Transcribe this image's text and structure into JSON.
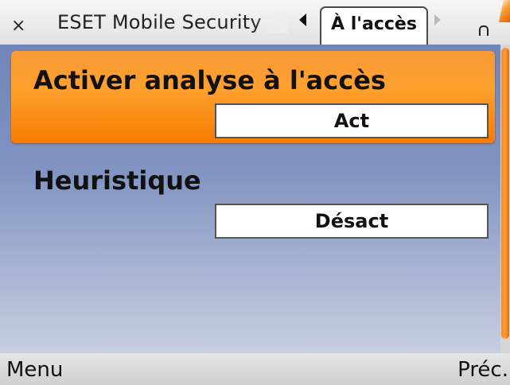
{
  "topbar": {
    "close_icon": "×",
    "app_title": "ESET Mobile Security",
    "active_tab_label": "À l'accès",
    "left_arrow_icon": "tab-prev-arrow",
    "right_arrow_icon": "tab-next-arrow",
    "indicator_icon": "lock-indicator-icon"
  },
  "settings": {
    "items": [
      {
        "label": "Activer analyse à l'accès",
        "value": "Act",
        "selected": true
      },
      {
        "label": "Heuristique",
        "value": "Désact",
        "selected": false
      }
    ]
  },
  "softkeys": {
    "left": "Menu",
    "right": "Préc."
  },
  "colors": {
    "selected_highlight": "#f78a18",
    "background_top": "#7085b7",
    "background_bottom": "#c7cfe0"
  }
}
